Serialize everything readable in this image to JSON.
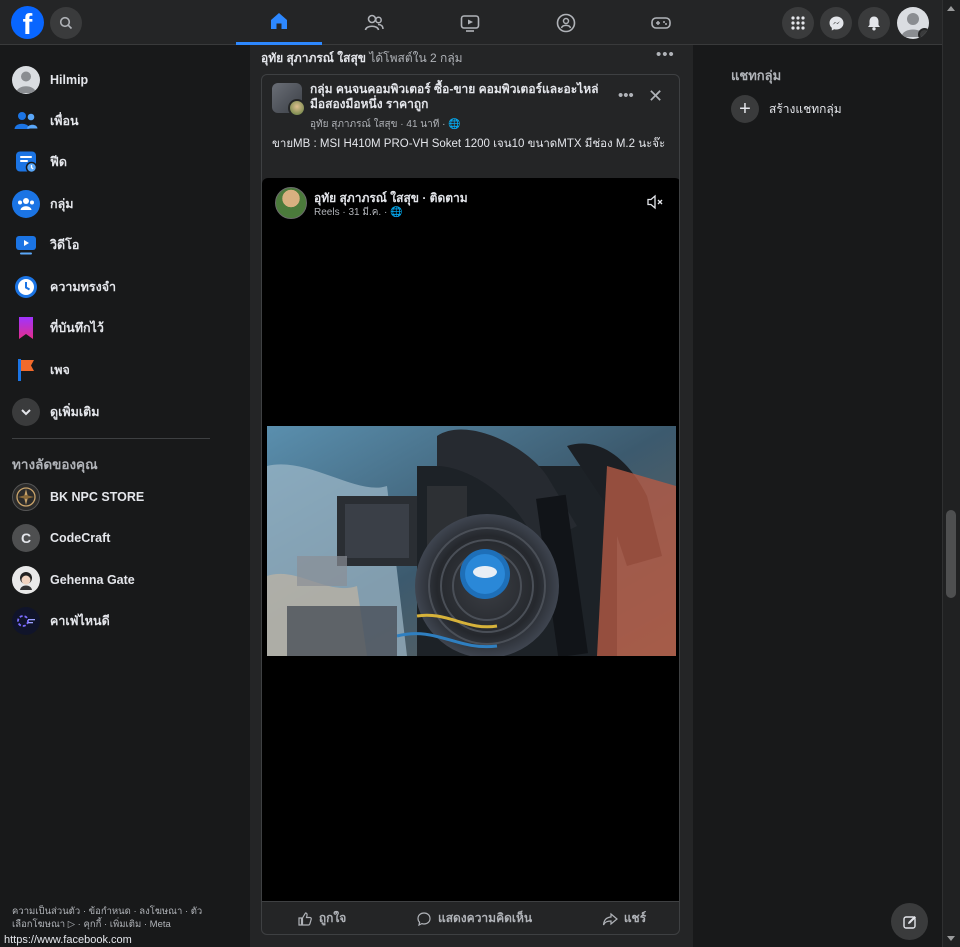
{
  "topbar": {
    "logo": "f",
    "nav": [
      "home-icon",
      "friends-icon",
      "watch-icon",
      "groups-icon",
      "gaming-icon"
    ],
    "right": [
      "menu-grid-icon",
      "messenger-icon",
      "notifications-icon"
    ]
  },
  "sidebar": {
    "items": [
      {
        "label": "Hilmip"
      },
      {
        "label": "เพื่อน"
      },
      {
        "label": "ฟีด"
      },
      {
        "label": "กลุ่ม"
      },
      {
        "label": "วิดีโอ"
      },
      {
        "label": "ความทรงจำ"
      },
      {
        "label": "ที่บันทึกไว้"
      },
      {
        "label": "เพจ"
      },
      {
        "label": "ดูเพิ่มเติม"
      }
    ],
    "shortcuts_title": "ทางลัดของคุณ",
    "shortcuts": [
      {
        "label": "BK NPC STORE"
      },
      {
        "label": "CodeCraft",
        "initial": "C"
      },
      {
        "label": "Gehenna Gate"
      },
      {
        "label": "คาเฟ่ไหนดี"
      }
    ],
    "footer": "ความเป็นส่วนตัว · ข้อกำหนด · ลงโฆษณา · ตัวเลือกโฆษณา ▷ · คุกกี้ · เพิ่มเติม · Meta"
  },
  "status_url": "https://www.facebook.com",
  "post": {
    "author": "อุทัย สุภาภรณ์ ใสสุข",
    "action": "ได้โพสต์ใน 2 กลุ่ม",
    "group_title": "กลุ่ม คนจนคอมพิวเตอร์ ซื้อ-ขาย คอมพิวเตอร์และอะไหล่ มือสองมือหนึ่ง ราคาถูก",
    "group_meta": "อุทัย สุภาภรณ์ ใสสุข · 41 นาที · 🌐",
    "text": "ขายMB : MSI H410M PRO-VH Soket 1200 เจน10  ขนาดMTX  มีช่อง M.2  นะจ๊ะ",
    "shared": {
      "name": "อุทัย สุภาภรณ์ ใสสุข · ติดตาม",
      "meta": "Reels · 31 มี.ค. · 🌐"
    },
    "actions": {
      "like": "ถูกใจ",
      "comment": "แสดงความคิดเห็น",
      "share": "แชร์"
    }
  },
  "right_panel": {
    "title": "แชทกลุ่ม",
    "create": "สร้างแชทกลุ่ม"
  },
  "colors": {
    "accent": "#2d88ff",
    "bg": "#18191a",
    "surface": "#242526"
  }
}
